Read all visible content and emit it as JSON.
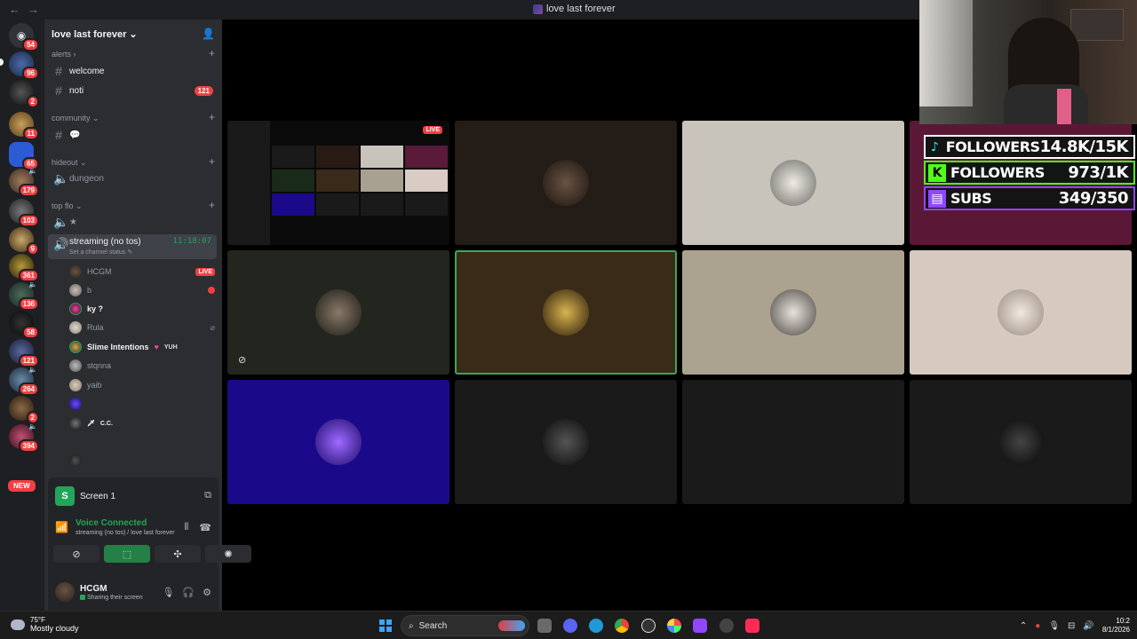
{
  "window": {
    "title": "love last forever"
  },
  "rail": {
    "badges": [
      "54",
      "96",
      "2",
      "11",
      "65",
      "179",
      "103",
      "9",
      "361",
      "136",
      "58",
      "121",
      "264",
      "2",
      "394"
    ],
    "new_label": "NEW"
  },
  "server": {
    "name": "love last forever"
  },
  "categories": {
    "alerts": "alerts",
    "community": "community",
    "hideout": "hideout",
    "top_flo": "top flo"
  },
  "channels": {
    "welcome": "welcome",
    "noti": "noti",
    "noti_count": "121",
    "chat_emoji": "💬",
    "dungeon": "dungeon",
    "star": "★",
    "streaming": "streaming (no tos)",
    "streaming_time": "11:18:07",
    "streaming_status": "Set a channel status"
  },
  "members": [
    {
      "name": "HCGM",
      "badge": "LIVE"
    },
    {
      "name": "b"
    },
    {
      "name": "ky ?"
    },
    {
      "name": "Rula"
    },
    {
      "name": "Slime Intentions",
      "tag": "YUH"
    },
    {
      "name": "stqnna"
    },
    {
      "name": "yaib"
    },
    {
      "name": ""
    },
    {
      "name": "C.C."
    },
    {
      "name": ""
    }
  ],
  "panel": {
    "screen_label": "Screen 1",
    "screen_icon_letter": "S",
    "voice_title": "Voice Connected",
    "voice_sub": "streaming (no tos) / love last forever"
  },
  "user": {
    "name": "HCGM",
    "status": "Sharing their screen"
  },
  "grid": {
    "live_label": "LIVE"
  },
  "overlay": {
    "tiktok_label": "FOLLOWERS",
    "tiktok_value": "14.8K/15K",
    "kick_label": "FOLLOWERS",
    "kick_value": "973/1K",
    "twitch_label": "SUBS",
    "twitch_value": "349/350"
  },
  "taskbar": {
    "temp": "75°F",
    "weather": "Mostly cloudy",
    "search_placeholder": "Search",
    "time": "10:2",
    "date": "8/1/2026"
  }
}
